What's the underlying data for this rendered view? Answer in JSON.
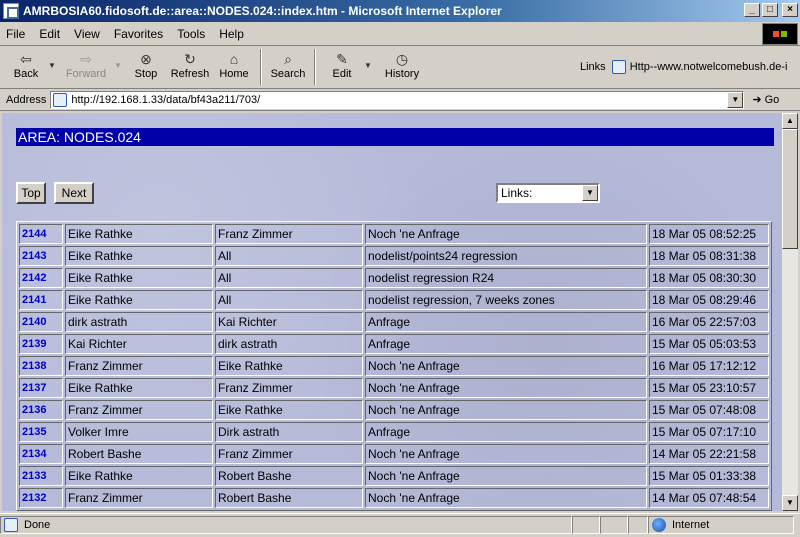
{
  "window": {
    "title": "AMRBOSIA60.fidosoft.de::area::NODES.024::index.htm - Microsoft Internet Explorer",
    "min_label": "_",
    "max_label": "□",
    "close_label": "×"
  },
  "menu": {
    "items": [
      {
        "label": "File"
      },
      {
        "label": "Edit"
      },
      {
        "label": "View"
      },
      {
        "label": "Favorites"
      },
      {
        "label": "Tools"
      },
      {
        "label": "Help"
      }
    ]
  },
  "toolbar": {
    "back": "Back",
    "forward": "Forward",
    "stop": "Stop",
    "refresh": "Refresh",
    "home": "Home",
    "search": "Search",
    "edit": "Edit",
    "history": "History",
    "links_label": "Links",
    "links_item": "Http--www.notwelcomebush.de-i"
  },
  "address": {
    "label": "Address",
    "url": "http://192.168.1.33/data/bf43a211/703/",
    "go_label": "Go"
  },
  "page": {
    "area_title": "AREA: NODES.024",
    "top_button": "Top",
    "next_button": "Next",
    "links_select": "Links:"
  },
  "messages": [
    {
      "num": "2144",
      "from": "Eike Rathke",
      "to": "Franz Zimmer",
      "subject": "Noch 'ne Anfrage",
      "date": "18 Mar 05 08:52:25"
    },
    {
      "num": "2143",
      "from": "Eike Rathke",
      "to": "All",
      "subject": "nodelist/points24 regression",
      "date": "18 Mar 05 08:31:38"
    },
    {
      "num": "2142",
      "from": "Eike Rathke",
      "to": "All",
      "subject": "nodelist regression R24",
      "date": "18 Mar 05 08:30:30"
    },
    {
      "num": "2141",
      "from": "Eike Rathke",
      "to": "All",
      "subject": "nodelist regression, 7 weeks zones",
      "date": "18 Mar 05 08:29:46"
    },
    {
      "num": "2140",
      "from": "dirk astrath",
      "to": "Kai Richter",
      "subject": "Anfrage",
      "date": "16 Mar 05 22:57:03"
    },
    {
      "num": "2139",
      "from": "Kai Richter",
      "to": "dirk astrath",
      "subject": "Anfrage",
      "date": "15 Mar 05 05:03:53"
    },
    {
      "num": "2138",
      "from": "Franz Zimmer",
      "to": "Eike Rathke",
      "subject": "Noch 'ne Anfrage",
      "date": "16 Mar 05 17:12:12"
    },
    {
      "num": "2137",
      "from": "Eike Rathke",
      "to": "Franz Zimmer",
      "subject": "Noch 'ne Anfrage",
      "date": "15 Mar 05 23:10:57"
    },
    {
      "num": "2136",
      "from": "Franz Zimmer",
      "to": "Eike Rathke",
      "subject": "Noch 'ne Anfrage",
      "date": "15 Mar 05 07:48:08"
    },
    {
      "num": "2135",
      "from": "Volker Imre",
      "to": "Dirk astrath",
      "subject": "Anfrage",
      "date": "15 Mar 05 07:17:10"
    },
    {
      "num": "2134",
      "from": "Robert Bashe",
      "to": "Franz Zimmer",
      "subject": "Noch 'ne Anfrage",
      "date": "14 Mar 05 22:21:58"
    },
    {
      "num": "2133",
      "from": "Eike Rathke",
      "to": "Robert Bashe",
      "subject": "Noch 'ne Anfrage",
      "date": "15 Mar 05 01:33:38"
    },
    {
      "num": "2132",
      "from": "Franz Zimmer",
      "to": "Robert Bashe",
      "subject": "Noch 'ne Anfrage",
      "date": "14 Mar 05 07:48:54"
    }
  ],
  "status": {
    "text": "Done",
    "zone": "Internet"
  },
  "icons": {
    "back": "back-arrow-icon",
    "forward": "forward-arrow-icon",
    "stop": "stop-icon",
    "refresh": "refresh-icon",
    "home": "home-icon",
    "search": "search-icon",
    "edit": "edit-icon",
    "history": "history-icon"
  },
  "colors": {
    "title_bar": "#0a246a",
    "area_bar": "#0000a8",
    "page_bg": "#b5bad9",
    "link_number": "#0000c0"
  }
}
